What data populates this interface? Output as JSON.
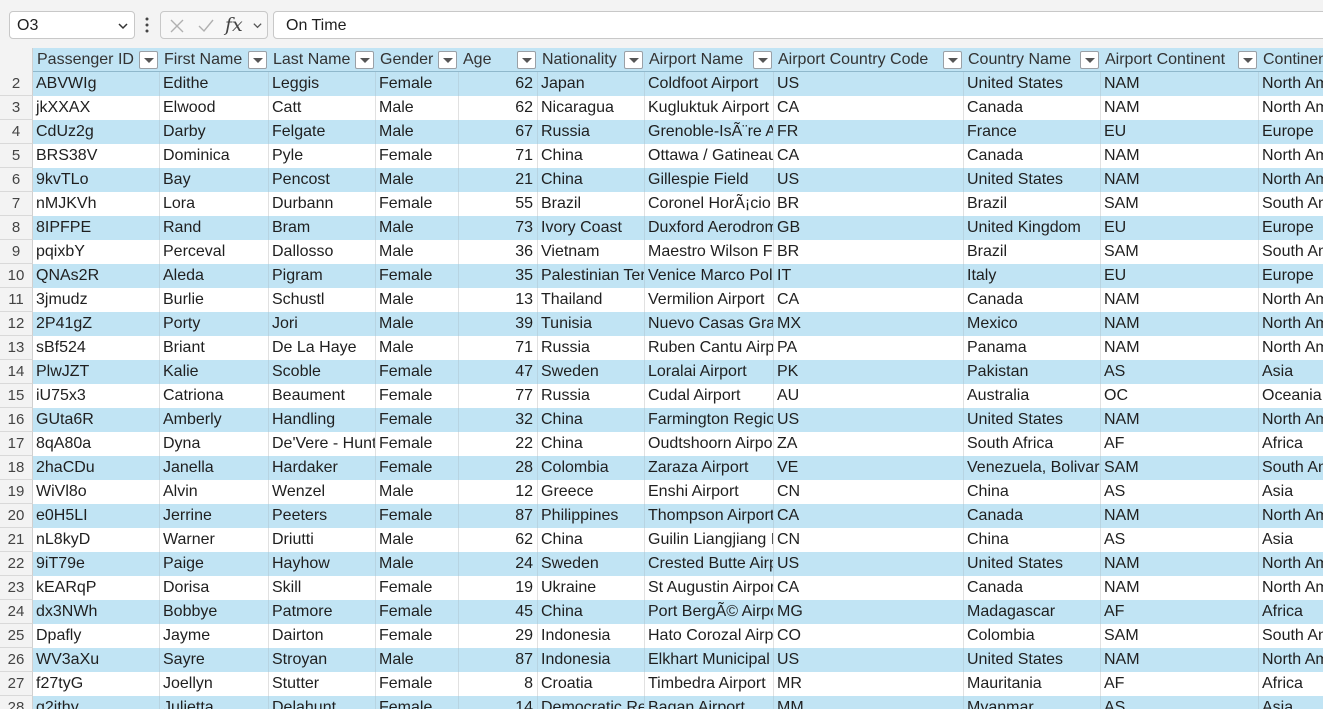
{
  "formula_bar": {
    "name_box": "O3",
    "formula_value": "On Time"
  },
  "columns": [
    "Passenger ID",
    "First Name",
    "Last Name",
    "Gender",
    "Age",
    "Nationality",
    "Airport Name",
    "Airport Country Code",
    "Country Name",
    "Airport Continent",
    "Continents"
  ],
  "rows": [
    {
      "n": "2",
      "c": [
        "ABVWIg",
        "Edithe",
        "Leggis",
        "Female",
        "62",
        "Japan",
        "Coldfoot Airport",
        "US",
        "United States",
        "NAM",
        "North America"
      ]
    },
    {
      "n": "3",
      "c": [
        "jkXXAX",
        "Elwood",
        "Catt",
        "Male",
        "62",
        "Nicaragua",
        "Kugluktuk Airport",
        "CA",
        "Canada",
        "NAM",
        "North America"
      ]
    },
    {
      "n": "4",
      "c": [
        "CdUz2g",
        "Darby",
        "Felgate",
        "Male",
        "67",
        "Russia",
        "Grenoble-IsÃ¨re Airport",
        "FR",
        "France",
        "EU",
        "Europe"
      ]
    },
    {
      "n": "5",
      "c": [
        "BRS38V",
        "Dominica",
        "Pyle",
        "Female",
        "71",
        "China",
        "Ottawa / Gatineau Airport",
        "CA",
        "Canada",
        "NAM",
        "North America"
      ]
    },
    {
      "n": "6",
      "c": [
        "9kvTLo",
        "Bay",
        "Pencost",
        "Male",
        "21",
        "China",
        "Gillespie Field",
        "US",
        "United States",
        "NAM",
        "North America"
      ]
    },
    {
      "n": "7",
      "c": [
        "nMJKVh",
        "Lora",
        "Durbann",
        "Female",
        "55",
        "Brazil",
        "Coronel HorÃ¡cio de Mattos Airport",
        "BR",
        "Brazil",
        "SAM",
        "South America"
      ]
    },
    {
      "n": "8",
      "c": [
        "8IPFPE",
        "Rand",
        "Bram",
        "Male",
        "73",
        "Ivory Coast",
        "Duxford Aerodrome",
        "GB",
        "United Kingdom",
        "EU",
        "Europe"
      ]
    },
    {
      "n": "9",
      "c": [
        "pqixbY",
        "Perceval",
        "Dallosso",
        "Male",
        "36",
        "Vietnam",
        "Maestro Wilson Fonseca Airport",
        "BR",
        "Brazil",
        "SAM",
        "South America"
      ]
    },
    {
      "n": "10",
      "c": [
        "QNAs2R",
        "Aleda",
        "Pigram",
        "Female",
        "35",
        "Palestinian Territory",
        "Venice Marco Polo Airport",
        "IT",
        "Italy",
        "EU",
        "Europe"
      ]
    },
    {
      "n": "11",
      "c": [
        "3jmudz",
        "Burlie",
        "Schustl",
        "Male",
        "13",
        "Thailand",
        "Vermilion Airport",
        "CA",
        "Canada",
        "NAM",
        "North America"
      ]
    },
    {
      "n": "12",
      "c": [
        "2P41gZ",
        "Porty",
        "Jori",
        "Male",
        "39",
        "Tunisia",
        "Nuevo Casas Grandes Airport",
        "MX",
        "Mexico",
        "NAM",
        "North America"
      ]
    },
    {
      "n": "13",
      "c": [
        "sBf524",
        "Briant",
        "De La Haye",
        "Male",
        "71",
        "Russia",
        "Ruben Cantu Airport",
        "PA",
        "Panama",
        "NAM",
        "North America"
      ]
    },
    {
      "n": "14",
      "c": [
        "PlwJZT",
        "Kalie",
        "Scoble",
        "Female",
        "47",
        "Sweden",
        "Loralai Airport",
        "PK",
        "Pakistan",
        "AS",
        "Asia"
      ]
    },
    {
      "n": "15",
      "c": [
        "iU75x3",
        "Catriona",
        "Beaument",
        "Female",
        "77",
        "Russia",
        "Cudal Airport",
        "AU",
        "Australia",
        "OC",
        "Oceania"
      ]
    },
    {
      "n": "16",
      "c": [
        "GUta6R",
        "Amberly",
        "Handling",
        "Female",
        "32",
        "China",
        "Farmington Regional Airport",
        "US",
        "United States",
        "NAM",
        "North America"
      ]
    },
    {
      "n": "17",
      "c": [
        "8qA80a",
        "Dyna",
        "De'Vere - Hunt",
        "Female",
        "22",
        "China",
        "Oudtshoorn Airport",
        "ZA",
        "South Africa",
        "AF",
        "Africa"
      ]
    },
    {
      "n": "18",
      "c": [
        "2haCDu",
        "Janella",
        "Hardaker",
        "Female",
        "28",
        "Colombia",
        "Zaraza Airport",
        "VE",
        "Venezuela, Bolivarian Republic of",
        "SAM",
        "South America"
      ]
    },
    {
      "n": "19",
      "c": [
        "WiVl8o",
        "Alvin",
        "Wenzel",
        "Male",
        "12",
        "Greece",
        "Enshi Airport",
        "CN",
        "China",
        "AS",
        "Asia"
      ]
    },
    {
      "n": "20",
      "c": [
        "e0H5LI",
        "Jerrine",
        "Peeters",
        "Female",
        "87",
        "Philippines",
        "Thompson Airport",
        "CA",
        "Canada",
        "NAM",
        "North America"
      ]
    },
    {
      "n": "21",
      "c": [
        "nL8kyD",
        "Warner",
        "Driutti",
        "Male",
        "62",
        "China",
        "Guilin Liangjiang International Airport",
        "CN",
        "China",
        "AS",
        "Asia"
      ]
    },
    {
      "n": "22",
      "c": [
        "9iT79e",
        "Paige",
        "Hayhow",
        "Male",
        "24",
        "Sweden",
        "Crested Butte Airpark",
        "US",
        "United States",
        "NAM",
        "North America"
      ]
    },
    {
      "n": "23",
      "c": [
        "kEARqP",
        "Dorisa",
        "Skill",
        "Female",
        "19",
        "Ukraine",
        "St Augustin Airport",
        "CA",
        "Canada",
        "NAM",
        "North America"
      ]
    },
    {
      "n": "24",
      "c": [
        "dx3NWh",
        "Bobbye",
        "Patmore",
        "Female",
        "45",
        "China",
        "Port BergÃ© Airport",
        "MG",
        "Madagascar",
        "AF",
        "Africa"
      ]
    },
    {
      "n": "25",
      "c": [
        "Dpafly",
        "Jayme",
        "Dairton",
        "Female",
        "29",
        "Indonesia",
        "Hato Corozal Airport",
        "CO",
        "Colombia",
        "SAM",
        "South America"
      ]
    },
    {
      "n": "26",
      "c": [
        "WV3aXu",
        "Sayre",
        "Stroyan",
        "Male",
        "87",
        "Indonesia",
        "Elkhart Municipal Airport",
        "US",
        "United States",
        "NAM",
        "North America"
      ]
    },
    {
      "n": "27",
      "c": [
        "f27tyG",
        "Joellyn",
        "Stutter",
        "Female",
        "8",
        "Croatia",
        "Timbedra Airport",
        "MR",
        "Mauritania",
        "AF",
        "Africa"
      ]
    },
    {
      "n": "28",
      "c": [
        "g2ithy",
        "Julietta",
        "Delahunt",
        "Female",
        "14",
        "Democratic Republic of the Congo",
        "Bagan Airport",
        "MM",
        "Myanmar",
        "AS",
        "Asia"
      ]
    }
  ],
  "colors": {
    "band": "#c1e4f4",
    "header_bg": "#f3f3f3"
  }
}
